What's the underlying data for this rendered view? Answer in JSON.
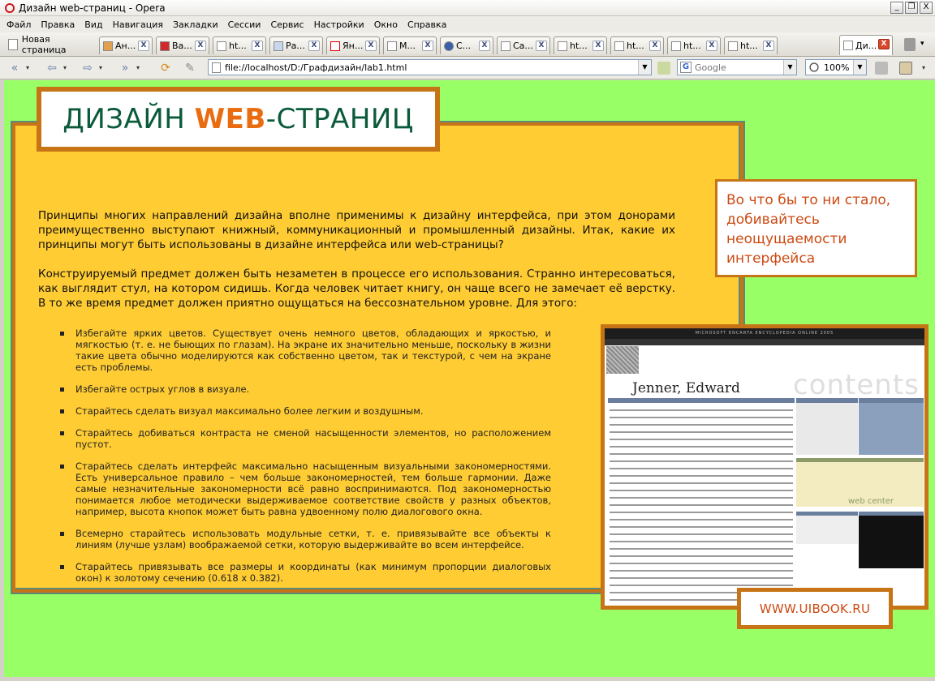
{
  "window": {
    "title": "Дизайн web-страниц - Opera",
    "buttons": {
      "minimize": "_",
      "maximize": "❐",
      "close": "X"
    }
  },
  "menu": [
    "Файл",
    "Правка",
    "Вид",
    "Навигация",
    "Закладки",
    "Сессии",
    "Сервис",
    "Настройки",
    "Окно",
    "Справка"
  ],
  "new_tab_label": "Новая страница",
  "tabs": [
    {
      "label": "Ан...",
      "icon": "wolf-favicon"
    },
    {
      "label": "Ва...",
      "icon": "e1-favicon"
    },
    {
      "label": "ht...",
      "icon": "page-favicon"
    },
    {
      "label": "Ра...",
      "icon": "pencil-favicon"
    },
    {
      "label": "Ян...",
      "icon": "yandex-favicon"
    },
    {
      "label": "М...",
      "icon": "page-favicon"
    },
    {
      "label": "С...",
      "icon": "globe-favicon"
    },
    {
      "label": "Са...",
      "icon": "page-favicon"
    },
    {
      "label": "ht...",
      "icon": "page-favicon"
    },
    {
      "label": "ht...",
      "icon": "page-favicon"
    },
    {
      "label": "ht...",
      "icon": "page-favicon"
    },
    {
      "label": "ht...",
      "icon": "page-favicon"
    },
    {
      "label": "Ди...",
      "icon": "page-favicon",
      "active": true
    }
  ],
  "tab_close": "X",
  "address": {
    "url": "file://localhost/D:/Графдизайн/lab1.html",
    "search_placeholder": "Google",
    "zoom": "100%"
  },
  "page": {
    "title_part1": "ДИЗАЙН ",
    "title_accent": "WEB",
    "title_part2": "-СТРАНИЦ",
    "intro": [
      "Принципы многих направлений дизайна вполне применимы к дизайну интерфейса, при этом донорами преимущественно выступают книжный, коммуникационный и промышленный дизайны. Итак, какие их принципы могут быть использованы в дизайне интерфейса или web-страницы?",
      "Конструируемый предмет должен быть незаметен в процессе его использования. Странно интересоваться, как выглядит стул, на котором сидишь. Когда человек читает книгу, он чаще всего не замечает её верстку. В то же время предмет должен приятно ощущаться на бессознательном уровне. Для этого:"
    ],
    "bullets": [
      "Избегайте ярких цветов. Существует очень немного цветов, обладающих и яркостью, и мягкостью (т. е. не быющих по глазам). На экране их значительно меньше, поскольку в жизни такие цвета обычно моделируются как собственно цветом, так и текстурой, с чем на экране есть проблемы.",
      "Избегайте острых углов в визуале.",
      "Старайтесь сделать визуал максимально более легким и воздушным.",
      "Старайтесь добиваться контраста не сменой насыщенности элементов, но расположением пустот.",
      "Старайтесь сделать интерфейс максимально насыщенным визуальными закономерностями. Есть универсальное правило – чем больше закономерностей, тем больше гармонии. Даже самые незначительные закономерности всё равно воспринимаются. Под закономерностью понимается любое методически выдерживаемое соответствие свойств у разных объектов, например, высота кнопок может быть равна удвоенному полю диалогового окна.",
      "Всемерно старайтесь использовать модульные сетки, т. е. привязывайте все объекты к линиям (лучше узлам) воображаемой сетки, которую выдерживайте во всем интерфейсе.",
      "Старайтесь привязывать все размеры и координаты (как минимум пропорции диалоговых окон) к золотому сечению (0.618 x 0.382)."
    ],
    "quote": "Во что бы то ни стало, добивайтесь неощущаемости интерфейса",
    "screenshot": {
      "header": "MICROSOFT ENCARTA ENCYCLOPEDIA ONLINE 2005",
      "name": "Jenner, Edward",
      "contents": "contents",
      "web_center": "web center"
    },
    "site": "WWW.UIBOOK.RU"
  },
  "colors": {
    "page_bg": "#99ff66",
    "panel_bg": "#ffcc33",
    "accent_orange": "#c77416",
    "title_green": "#0b5a3a",
    "quote_red": "#cc4a12"
  }
}
